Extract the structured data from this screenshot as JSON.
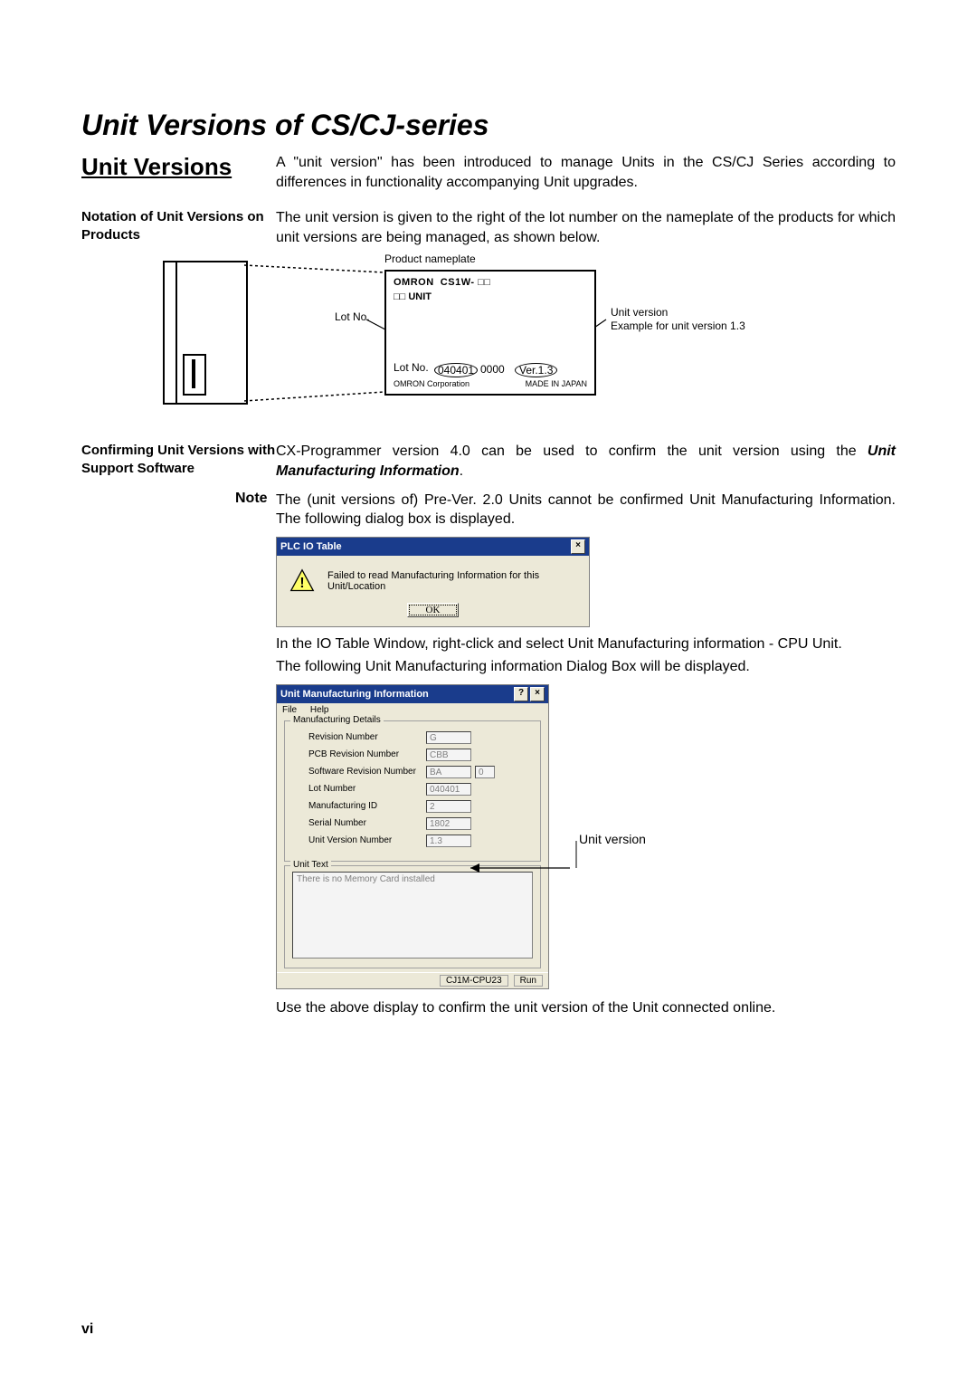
{
  "page_number": "vi",
  "title_main": "Unit Versions of CS/CJ-series",
  "title_sub": "Unit Versions",
  "intro": "A \"unit version\" has been introduced to manage Units in the CS/CJ Series according to differences in functionality accompanying Unit upgrades.",
  "sect1_label": "Notation of Unit Versions on Products",
  "sect1_body": "The unit version is given to the right of the lot number on the nameplate of the products for which unit versions are being managed, as shown below.",
  "fig": {
    "product_nameplate": "Product nameplate",
    "lot_no_label": "Lot No.",
    "unit_version_label": "Unit version",
    "unit_version_example": "Example for unit version 1.3",
    "brand_line": "OMRON",
    "model_line": "CS1W- □□",
    "unit_line": "□□ UNIT",
    "lot_line_prefix": "Lot No.",
    "lot_value": "040401",
    "lot_suffix": "0000",
    "ver_text": "Ver.1.3",
    "corp": "OMRON Corporation",
    "mij": "MADE IN JAPAN"
  },
  "sect2_label": "Confirming Unit Versions with Support Software",
  "sect2_body_a": "CX-Programmer version 4.0 can be used to confirm the unit version using the ",
  "sect2_body_b": "Unit Manufacturing Information",
  "sect2_body_c": ".",
  "note": {
    "label": "Note",
    "a": "The (unit versions of) Pre-Ver. 2.0 Units cannot be confirmed ",
    "b": "Unit Manufacturing Information",
    "c": ". The following dialog box is displayed."
  },
  "dlg1": {
    "title": "PLC IO Table",
    "msg": "Failed to read Manufacturing Information for this Unit/Location",
    "ok": "OK"
  },
  "after_dlg1_a": "In the ",
  "after_dlg1_b": "IO Table",
  "after_dlg1_c": " Window, right-click and select ",
  "after_dlg1_d": "Unit Manufacturing information - CPU Unit.",
  "after_dlg1_2a": "The following ",
  "after_dlg1_2b": "Unit Manufacturing information",
  "after_dlg1_2c": " Dialog Box will be displayed.",
  "dlg2": {
    "title": "Unit Manufacturing Information",
    "menu_file": "File",
    "menu_help": "Help",
    "group1": "Manufacturing Details",
    "f_rev": "Revision Number",
    "v_rev": "G",
    "f_pcb": "PCB Revision Number",
    "v_pcb": "CBB",
    "f_sw": "Software Revision Number",
    "v_sw_a": "BA",
    "v_sw_b": "0",
    "f_lot": "Lot Number",
    "v_lot": "040401",
    "f_mid": "Manufacturing ID",
    "v_mid": "2",
    "f_ser": "Serial Number",
    "v_ser": "1802",
    "f_uvn": "Unit Version Number",
    "v_uvn": "1.3",
    "group2": "Unit Text",
    "unit_text": "There is no Memory Card installed",
    "status_a": "CJ1M-CPU23",
    "status_b": "Run",
    "callout": "Unit version"
  },
  "closing": "Use the above display to confirm the unit version of the Unit connected online."
}
